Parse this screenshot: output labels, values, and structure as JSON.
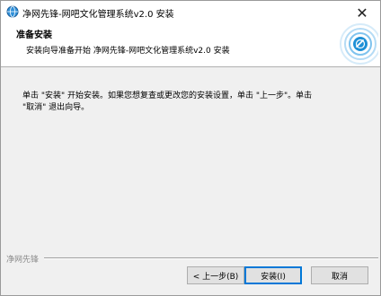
{
  "window": {
    "title": "净网先锋-网吧文化管理系统v2.0 安装",
    "close_glyph": "✕"
  },
  "header": {
    "title": "准备安装",
    "subtitle": "安装向导准备开始 净网先锋-网吧文化管理系统v2.0 安装"
  },
  "body": {
    "line1": "单击 \"安装\" 开始安装。如果您想复查或更改您的安装设置，单击 \"上一步\"。单击",
    "line2": "\"取消\" 退出向导。"
  },
  "footer": {
    "brand": "净网先锋",
    "back_label": "< 上一步(B)",
    "install_label": "安装(I)",
    "cancel_label": "取消"
  },
  "icons": {
    "app_icon": "app-globe-icon",
    "header_logo": "ripple-logo-icon"
  },
  "colors": {
    "accent": "#0078d7",
    "logo_blue": "#1e90d6"
  }
}
